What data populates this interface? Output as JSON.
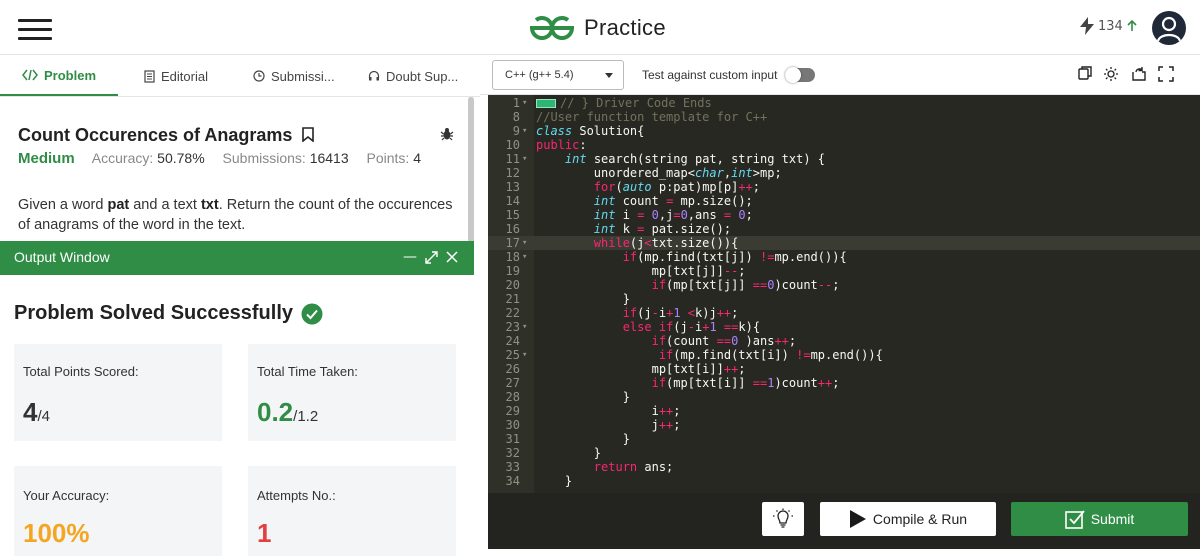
{
  "header": {
    "brand": "Practice",
    "streak_count": "134"
  },
  "tabs": [
    {
      "label": "Problem"
    },
    {
      "label": "Editorial"
    },
    {
      "label": "Submissi..."
    },
    {
      "label": "Doubt Sup..."
    }
  ],
  "problem": {
    "title": "Count Occurences of Anagrams",
    "difficulty": "Medium",
    "accuracy_label": "Accuracy:",
    "accuracy_value": "50.78%",
    "submissions_label": "Submissions:",
    "submissions_value": "16413",
    "points_label": "Points:",
    "points_value": "4",
    "desc_1": "Given a word ",
    "desc_word": "pat",
    "desc_2": " and a text ",
    "desc_text": "txt",
    "desc_3": ". Return the count of the occurences of anagrams of the word in the text."
  },
  "output": {
    "title": "Output Window",
    "success": "Problem Solved Successfully",
    "cards": [
      {
        "label": "Total Points Scored:",
        "value": "4",
        "sub": "/4",
        "color": "#333333"
      },
      {
        "label": "Total Time Taken:",
        "value": "0.2",
        "sub": "/1.2",
        "color": "#2f8d46"
      },
      {
        "label": "Your Accuracy:",
        "value": "100%",
        "sub": "",
        "color": "#f4a623"
      },
      {
        "label": "Attempts No.:",
        "value": "1",
        "sub": "",
        "color": "#e23f3f"
      }
    ]
  },
  "editor": {
    "language": "C++ (g++ 5.4)",
    "custom_input_label": "Test against custom input",
    "lines": [
      {
        "n": "1",
        "fold": true,
        "html": "<span class='fb'></span><span class='c'>// } Driver Code Ends</span>"
      },
      {
        "n": "8",
        "fold": false,
        "html": "<span class='c'>//User function template for C++</span>"
      },
      {
        "n": "9",
        "fold": true,
        "html": "<span class='t'>class</span> Solution{"
      },
      {
        "n": "10",
        "fold": false,
        "html": "<span class='k'>public</span>:"
      },
      {
        "n": "11",
        "fold": true,
        "html": "    <span class='t'>int</span> search(string pat, string txt) {"
      },
      {
        "n": "12",
        "fold": false,
        "html": "        unordered_map&lt;<span class='t'>char</span>,<span class='t'>int</span>&gt;mp;"
      },
      {
        "n": "13",
        "fold": false,
        "html": "        <span class='k'>for</span>(<span class='t'>auto</span> p:pat)mp[p]<span class='k'>++</span>;"
      },
      {
        "n": "14",
        "fold": false,
        "html": "        <span class='t'>int</span> count <span class='k'>=</span> mp.size();"
      },
      {
        "n": "15",
        "fold": false,
        "html": "        <span class='t'>int</span> i <span class='k'>=</span> <span class='n'>0</span>,j<span class='k'>=</span><span class='n'>0</span>,ans <span class='k'>=</span> <span class='n'>0</span>;"
      },
      {
        "n": "16",
        "fold": false,
        "html": "        <span class='t'>int</span> k <span class='k'>=</span> pat.size();"
      },
      {
        "n": "17",
        "fold": true,
        "hl": true,
        "html": "        <span class='k'>while</span>(j<span class='k'>&lt;</span>txt.size()){"
      },
      {
        "n": "18",
        "fold": true,
        "html": "            <span class='k'>if</span>(mp.find(txt[j]) <span class='k'>!=</span>mp.end()){"
      },
      {
        "n": "19",
        "fold": false,
        "html": "                mp[txt[j]]<span class='k'>--</span>;"
      },
      {
        "n": "20",
        "fold": false,
        "html": "                <span class='k'>if</span>(mp[txt[j]] <span class='k'>==</span><span class='n'>0</span>)count<span class='k'>--</span>;"
      },
      {
        "n": "21",
        "fold": false,
        "html": "            }"
      },
      {
        "n": "22",
        "fold": false,
        "html": "            <span class='k'>if</span>(j<span class='k'>-</span>i<span class='k'>+</span><span class='n'>1</span> <span class='k'>&lt;</span>k)j<span class='k'>++</span>;"
      },
      {
        "n": "23",
        "fold": true,
        "html": "            <span class='k'>else</span> <span class='k'>if</span>(j<span class='k'>-</span>i<span class='k'>+</span><span class='n'>1</span> <span class='k'>==</span>k){"
      },
      {
        "n": "24",
        "fold": false,
        "html": "                <span class='k'>if</span>(count <span class='k'>==</span><span class='n'>0</span> )ans<span class='k'>++</span>;"
      },
      {
        "n": "25",
        "fold": true,
        "html": "                 <span class='k'>if</span>(mp.find(txt[i]) <span class='k'>!=</span>mp.end()){"
      },
      {
        "n": "26",
        "fold": false,
        "html": "                mp[txt[i]]<span class='k'>++</span>;"
      },
      {
        "n": "27",
        "fold": false,
        "html": "                <span class='k'>if</span>(mp[txt[i]] <span class='k'>==</span><span class='n'>1</span>)count<span class='k'>++</span>;"
      },
      {
        "n": "28",
        "fold": false,
        "html": "            }"
      },
      {
        "n": "29",
        "fold": false,
        "html": "                i<span class='k'>++</span>;"
      },
      {
        "n": "30",
        "fold": false,
        "html": "                j<span class='k'>++</span>;"
      },
      {
        "n": "31",
        "fold": false,
        "html": "            }"
      },
      {
        "n": "32",
        "fold": false,
        "html": "        }"
      },
      {
        "n": "33",
        "fold": false,
        "html": "        <span class='k'>return</span> ans;"
      },
      {
        "n": "34",
        "fold": false,
        "html": "    }"
      }
    ]
  },
  "actions": {
    "compile_run": "Compile & Run",
    "submit": "Submit"
  },
  "colors": {
    "brand_green": "#2f8d46",
    "editor_bg": "#272822"
  },
  "icons": [
    "menu-icon",
    "gfg-logo-icon",
    "lightning-icon",
    "arrow-up-icon",
    "user-icon",
    "code-icon",
    "editorial-icon",
    "clock-icon",
    "headset-icon",
    "bookmark-icon",
    "bug-icon",
    "minimize-icon",
    "expand-icon",
    "close-icon",
    "check-circle-icon",
    "copy-icon",
    "settings-icon",
    "reset-icon",
    "fullscreen-icon",
    "lightbulb-icon",
    "play-icon",
    "checkbox-icon"
  ]
}
